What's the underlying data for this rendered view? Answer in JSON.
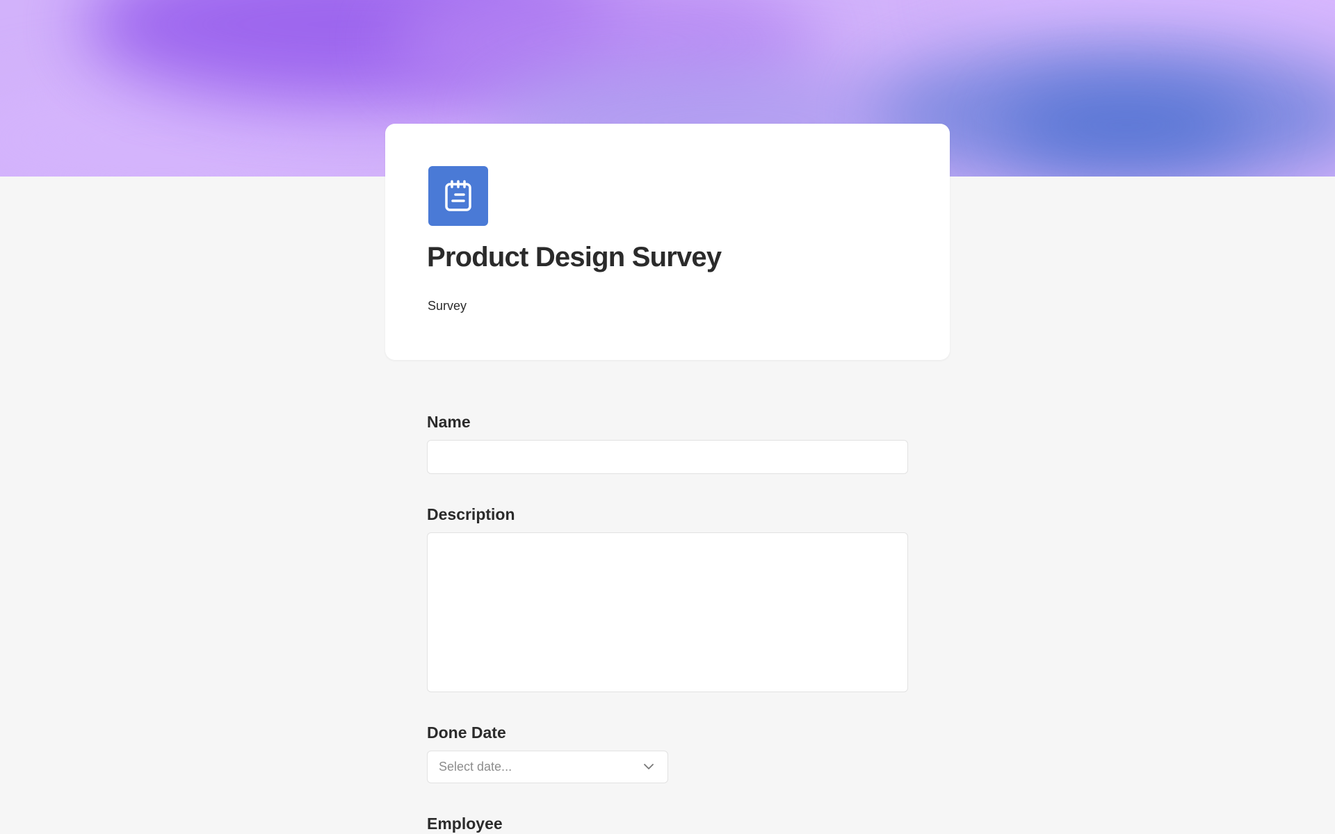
{
  "header": {
    "title": "Product Design Survey",
    "subtitle": "Survey",
    "icon": "notepad-icon"
  },
  "fields": [
    {
      "label": "Name",
      "type": "text",
      "value": ""
    },
    {
      "label": "Description",
      "type": "textarea",
      "value": ""
    },
    {
      "label": "Done Date",
      "type": "date",
      "placeholder": "Select date..."
    },
    {
      "label": "Employee",
      "type": "unknown"
    }
  ],
  "colors": {
    "background": "#f6f6f6",
    "card": "#ffffff",
    "icon_bg": "#4a7ad6",
    "banner_purple": "#9b63ee",
    "banner_blue": "#4f71d2",
    "text": "#2b2b2b",
    "placeholder": "#8d8d8d"
  }
}
